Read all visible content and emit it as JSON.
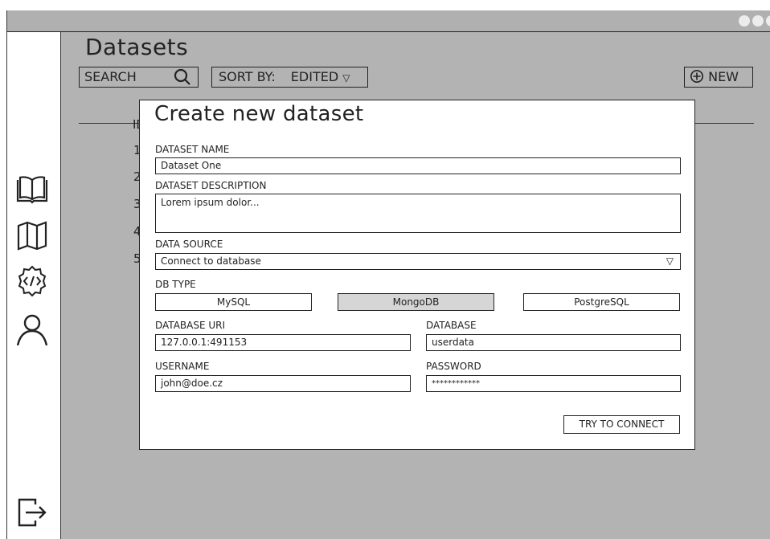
{
  "main": {
    "title": "Datasets",
    "search_label": "SEARCH",
    "sort_label": "SORT BY:",
    "sort_value": "EDITED",
    "new_label": "NEW",
    "table": {
      "id_header_fragment": "ID",
      "row_ids": [
        "1",
        "2",
        "3",
        "4",
        "5"
      ]
    }
  },
  "modal": {
    "title": "Create new dataset",
    "dataset_name_label": "DATASET NAME",
    "dataset_name_value": "Dataset One",
    "description_label": "DATASET DESCRIPTION",
    "description_value": "Lorem ipsum dolor...",
    "data_source_label": "DATA SOURCE",
    "data_source_value": "Connect to database",
    "db_type_label": "DB TYPE",
    "db_types": [
      "MySQL",
      "MongoDB",
      "PostgreSQL"
    ],
    "db_type_selected": "MongoDB",
    "database_uri_label": "DATABASE URI",
    "database_uri_value": "127.0.0.1:491153",
    "database_label": "DATABASE",
    "database_value": "userdata",
    "username_label": "USERNAME",
    "username_value": "john@doe.cz",
    "password_label": "PASSWORD",
    "password_value": "************",
    "connect_button": "TRY TO CONNECT"
  },
  "sidebar": {
    "icons": [
      "book-icon",
      "map-icon",
      "code-gear-icon",
      "user-icon",
      "logout-icon"
    ]
  },
  "colors": {
    "backdrop": "#b3b3b3",
    "selected_segment": "#d6d6d6",
    "frame": "#222222"
  }
}
